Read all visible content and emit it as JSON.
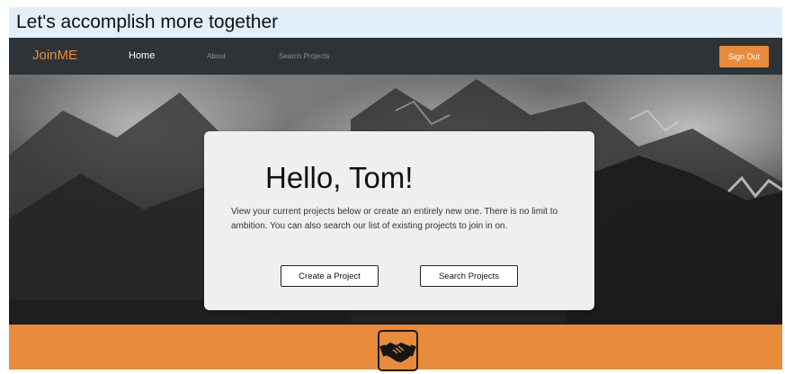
{
  "banner": {
    "text": "Let's accomplish more together"
  },
  "navbar": {
    "brand": "JoinME",
    "items": [
      {
        "label": "Home",
        "active": true
      },
      {
        "label": "About",
        "active": false
      },
      {
        "label": "Search Projects",
        "active": false
      }
    ],
    "sign_out_label": "Sign Out"
  },
  "hero": {
    "title": "Hello, Tom!",
    "text": "View your current projects below or create an entirely new one. There is no limit to ambition. You can also search our list of existing projects to join in on.",
    "buttons": {
      "create_label": "Create a Project",
      "search_label": "Search Projects"
    }
  },
  "footer": {
    "icon": "handshake-icon"
  },
  "colors": {
    "accent": "#e98b3c",
    "navbar": "#2e3338",
    "banner": "#e2effb",
    "card": "#efefef"
  }
}
